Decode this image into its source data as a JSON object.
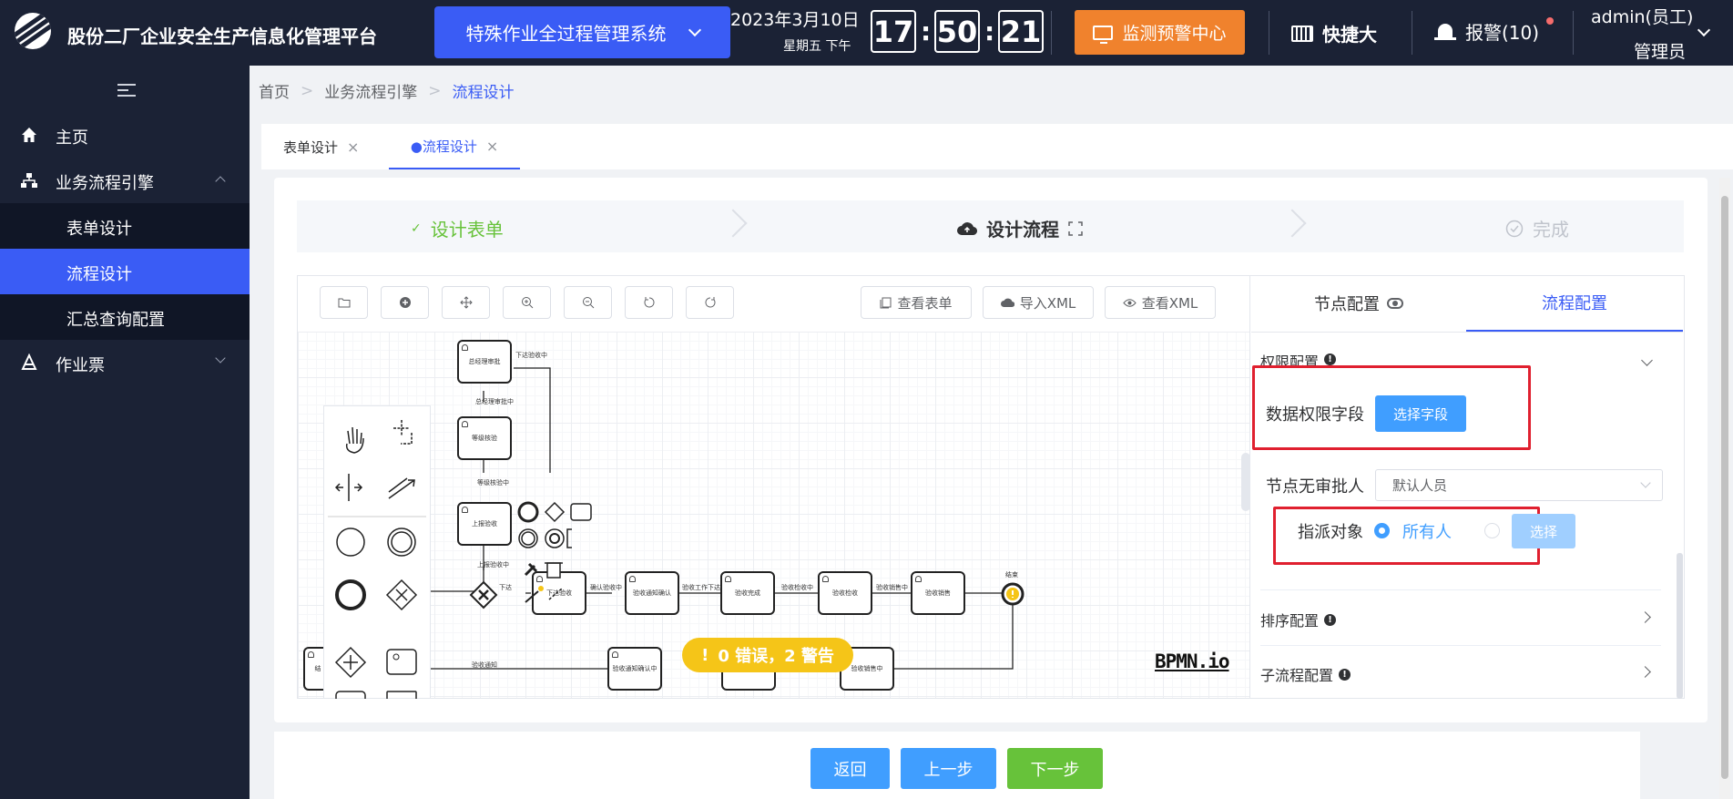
{
  "header": {
    "app_title": "股份二厂企业安全生产信息化管理平台",
    "system_select": "特殊作业全过程管理系统",
    "date": "2023年3月10日",
    "weekday": "星期五 下午",
    "clock": {
      "h": "17",
      "m": "50",
      "s": "21",
      "sep": ":"
    },
    "monitor_label": "监测预警中心",
    "quick_label": "快捷大",
    "alarm_label": "报警(10)",
    "user_name": "admin(员工)",
    "user_role": "管理员",
    "brand_color": "#3a5cf5"
  },
  "sidebar": {
    "items": [
      {
        "label": "主页",
        "icon": "home-icon"
      },
      {
        "label": "业务流程引擎",
        "icon": "workflow-icon"
      },
      {
        "label": "表单设计"
      },
      {
        "label": "流程设计"
      },
      {
        "label": "汇总查询配置"
      },
      {
        "label": "作业票",
        "icon": "ticket-icon"
      }
    ]
  },
  "breadcrumb": [
    "首页",
    "业务流程引擎",
    "流程设计"
  ],
  "tabs": [
    {
      "label": "表单设计",
      "close": "×"
    },
    {
      "label": "●流程设计",
      "close": "×"
    }
  ],
  "steps": [
    {
      "label": "设计表单",
      "mark": "✓",
      "state": "done"
    },
    {
      "label": "设计流程",
      "state": "current"
    },
    {
      "label": "完成",
      "state": "pending"
    }
  ],
  "toolbar": {
    "view_form": "查看表单",
    "import_xml": "导入XML",
    "view_xml": "查看XML",
    "icons": [
      "folder-icon",
      "add-circle-icon",
      "move-icon",
      "zoom-in-icon",
      "zoom-out-icon",
      "undo-icon",
      "redo-icon"
    ]
  },
  "diagram": {
    "tasks": [
      "总经理审批",
      "等级核验",
      "上报验收",
      "下达验收",
      "验收通知确认",
      "验收完成",
      "验收检收",
      "验收销售",
      "验收通知确认中",
      "验收销售中",
      "结"
    ],
    "flows": [
      "下达验收中",
      "总经理审批中",
      "等级核验中",
      "上报验收中",
      "下达",
      "确认验收中",
      "验收工作下达",
      "验收检收中",
      "验收销售中",
      "验收通知",
      "结束"
    ],
    "status": "0 错误，2 警告",
    "status_mark": "!",
    "brand": "BPMN.io"
  },
  "rpanel": {
    "tabs": [
      "节点配置",
      "流程配置"
    ],
    "permission_section": "权限配置",
    "data_permission_label": "数据权限字段",
    "select_field_button": "选择字段",
    "no_approver_label": "节点无审批人",
    "no_approver_value": "默认人员",
    "assign_label": "指派对象",
    "assign_option_all": "所有人",
    "assign_select_button": "选择",
    "sort_config": "排序配置",
    "subprocess_config": "子流程配置",
    "info_mark": "!"
  },
  "footer": {
    "back": "返回",
    "prev": "上一步",
    "next": "下一步"
  }
}
